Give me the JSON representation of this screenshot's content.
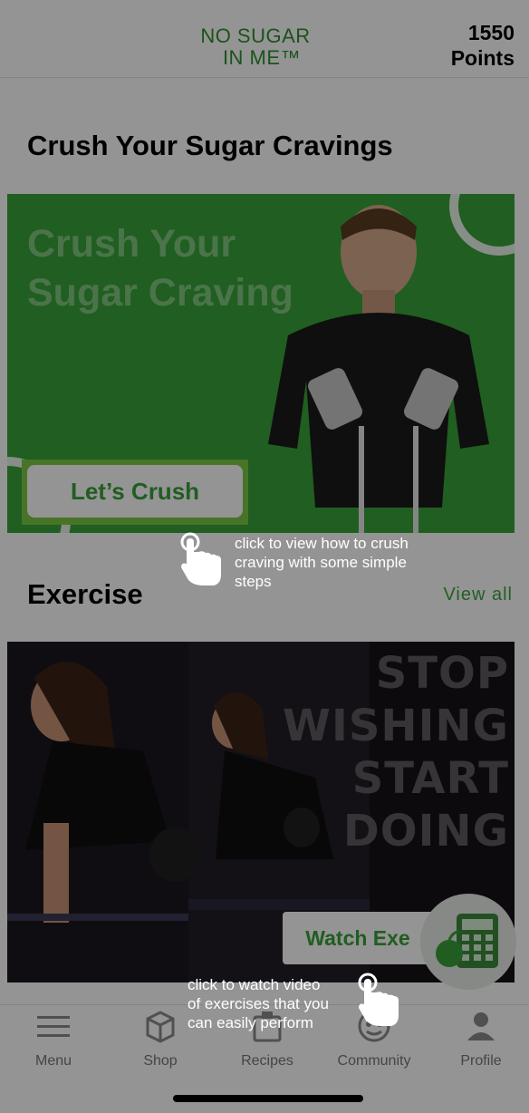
{
  "header": {
    "logo_line1": "NO SUGAR",
    "logo_line2": "IN ME™",
    "points_value": "1550",
    "points_label": "Points"
  },
  "craving": {
    "section_title": "Crush Your Sugar Cravings",
    "banner_line1": "Crush Your",
    "banner_line2": "Sugar Craving",
    "button_label": "Let’s Crush"
  },
  "exercise": {
    "section_title": "Exercise",
    "view_all": "View all",
    "banner_lines": [
      "STOP",
      "WISHING",
      "START",
      "DOING"
    ],
    "button_label": "Watch Exe"
  },
  "tooltips": {
    "crush_tip": [
      "click to view how to crush",
      "craving with some simple",
      "steps"
    ],
    "watch_tip": [
      "click to watch video",
      "of exercises that you",
      "can easily perform"
    ]
  },
  "tabs": [
    {
      "label": "Menu",
      "icon": "menu-icon"
    },
    {
      "label": "Shop",
      "icon": "box-icon"
    },
    {
      "label": "Recipes",
      "icon": "recipes-icon"
    },
    {
      "label": "Community",
      "icon": "community-icon"
    },
    {
      "label": "Profile",
      "icon": "profile-icon"
    }
  ],
  "colors": {
    "brand_green": "#3aa03a",
    "banner_green": "#39a23a",
    "highlight_green": "#7ac843"
  }
}
